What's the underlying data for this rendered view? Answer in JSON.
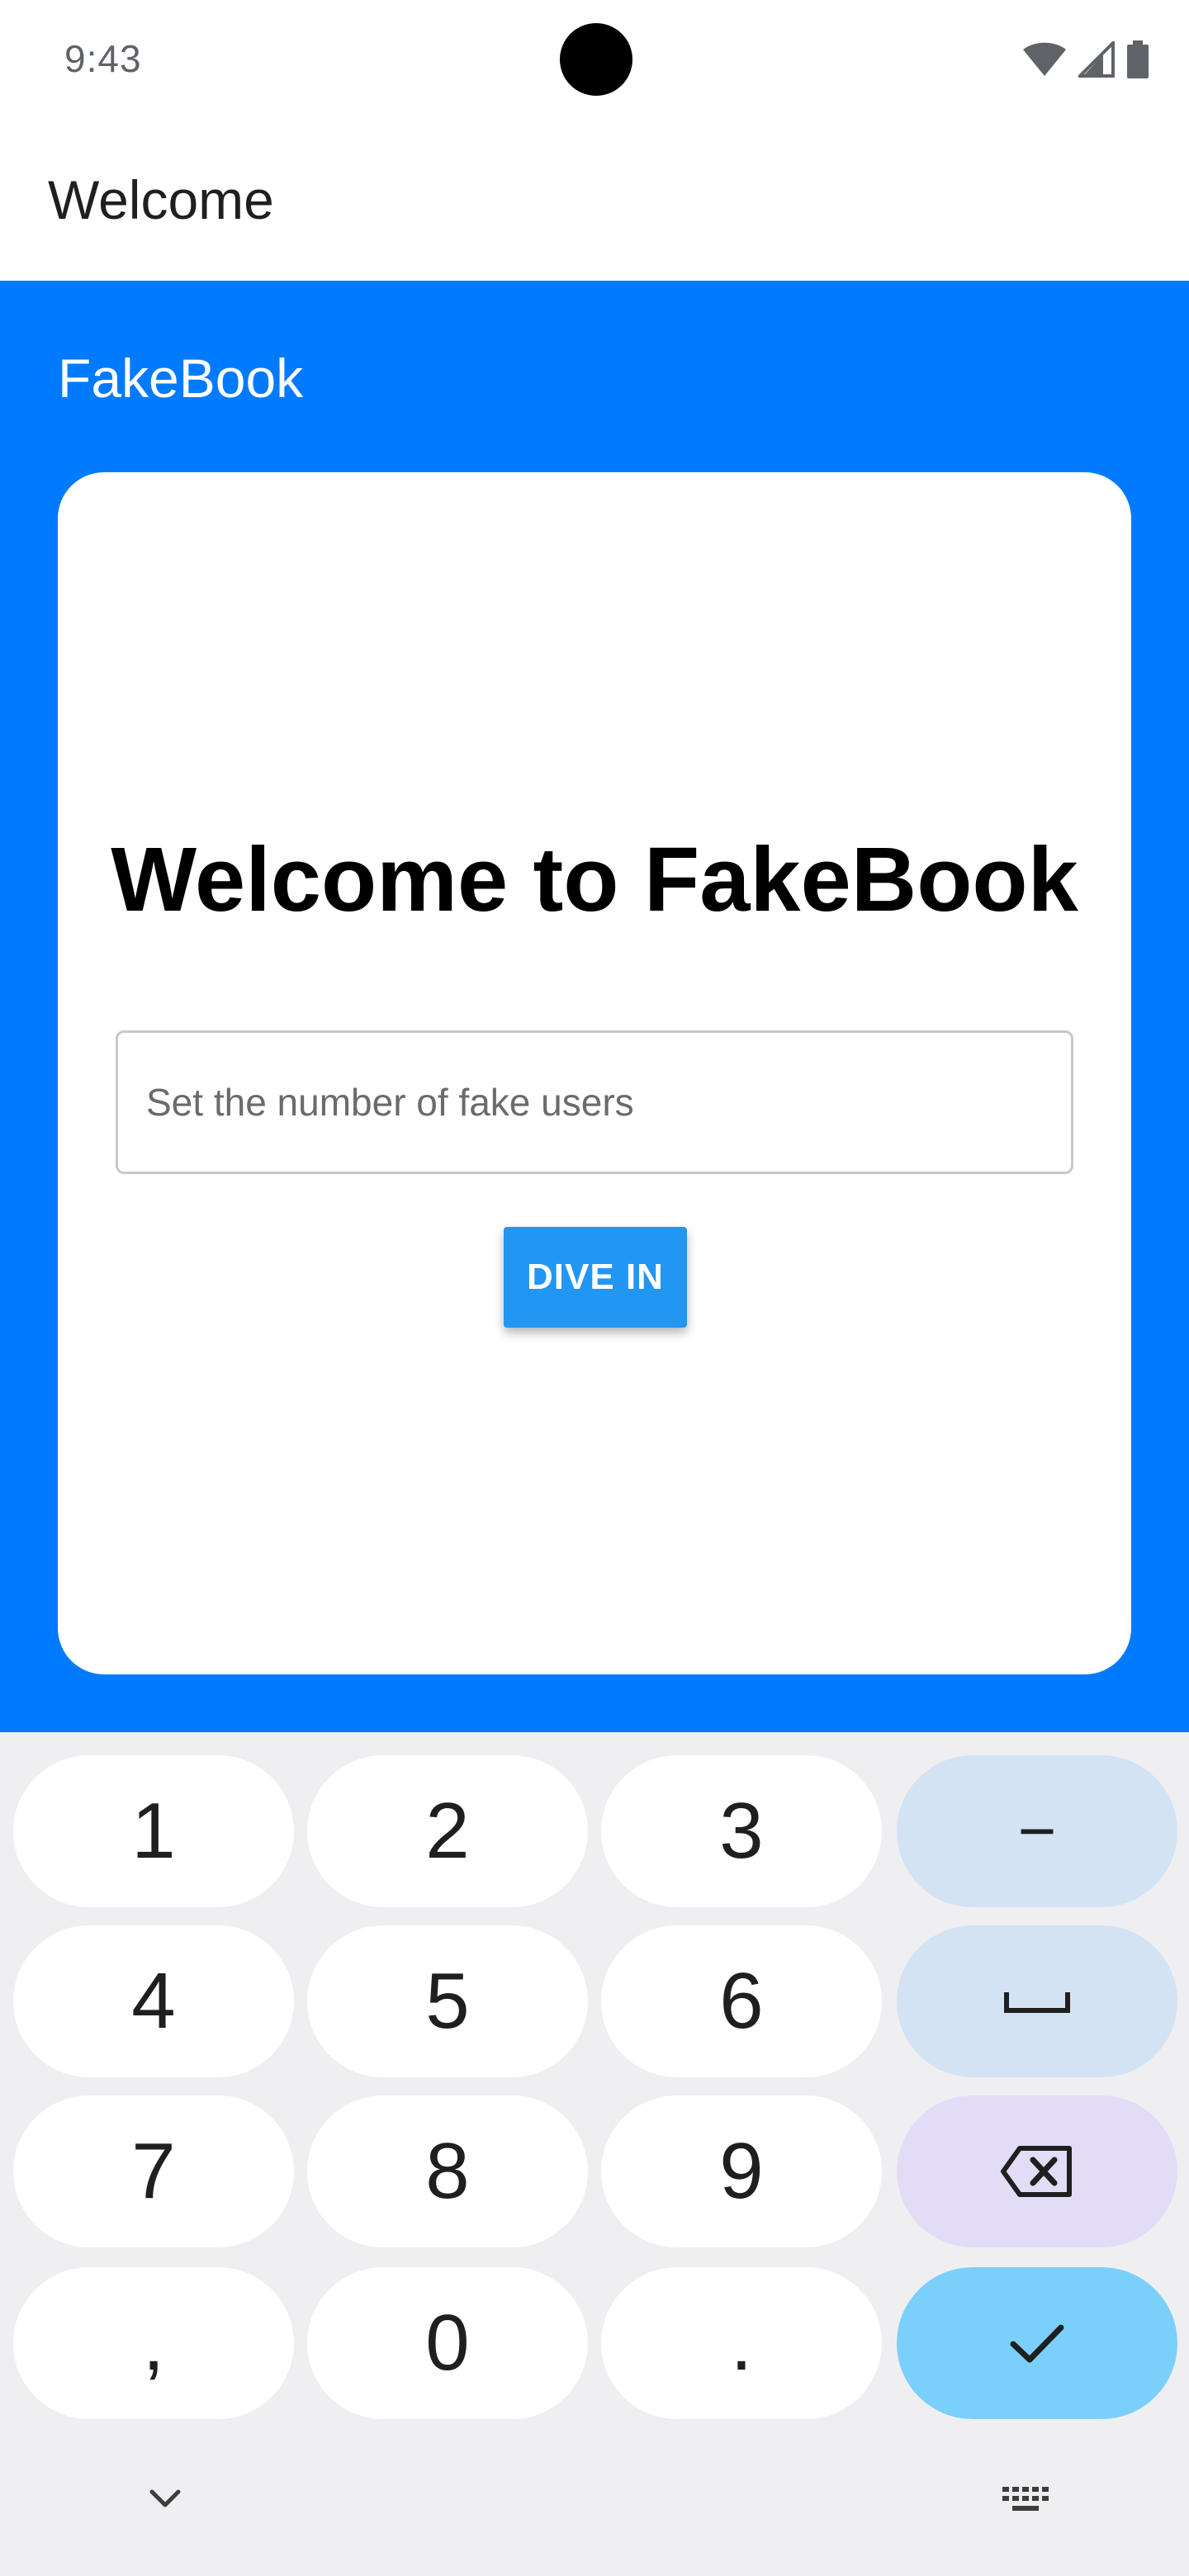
{
  "status_bar": {
    "time": "9:43",
    "icons": [
      "wifi-icon",
      "cell-signal-icon",
      "battery-icon"
    ]
  },
  "app_bar": {
    "title": "Welcome"
  },
  "brand": {
    "name": "FakeBook"
  },
  "card": {
    "title": "Welcome to FakeBook",
    "input_placeholder": "Set the number of fake users",
    "input_value": "",
    "button_label": "DIVE IN"
  },
  "keyboard": {
    "keys": [
      "1",
      "2",
      "3",
      "−",
      "4",
      "5",
      "6",
      "space",
      "7",
      "8",
      "9",
      "backspace",
      ",",
      "0",
      ".",
      "done"
    ],
    "key_1": "1",
    "key_2": "2",
    "key_3": "3",
    "key_minus": "−",
    "key_4": "4",
    "key_5": "5",
    "key_6": "6",
    "key_7": "7",
    "key_8": "8",
    "key_9": "9",
    "key_comma": ",",
    "key_0": "0",
    "key_period": "."
  },
  "colors": {
    "primary_blue": "#007bff",
    "button_blue": "#2196f3",
    "keyboard_bg": "#efeff2",
    "function_key": "#d3e3f4",
    "delete_key": "#e3dcf7",
    "enter_key": "#7ad0fb"
  }
}
